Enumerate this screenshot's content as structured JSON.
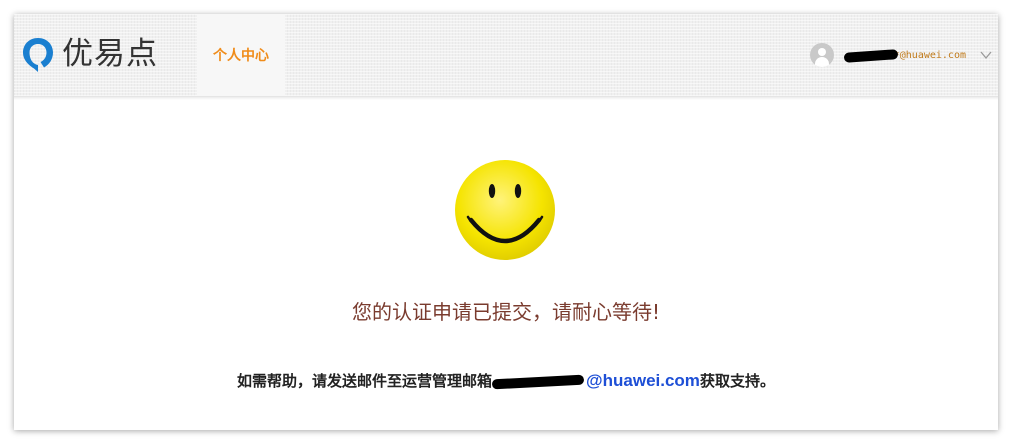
{
  "header": {
    "logo_text": "优易点",
    "nav_tab_label": "个人中心",
    "user_email": "*@huawei.com",
    "logo_icon": "q-logo-icon",
    "avatar_icon": "user-avatar-icon",
    "caret_icon": "chevron-down-icon"
  },
  "main": {
    "smiley_icon": "smiley-face-icon",
    "status_message": "您的认证申请已提交，请耐心等待!",
    "help_prefix": "如需帮助，请发送邮件至运营管理邮箱",
    "help_email": "@huawei.com",
    "help_suffix": "获取支持。"
  },
  "colors": {
    "accent_orange": "#f08c1a",
    "logo_blue": "#1a7fd0",
    "status_text": "#7a3b2e",
    "link_blue": "#1e4fd6",
    "smiley_yellow": "#f5e400"
  }
}
